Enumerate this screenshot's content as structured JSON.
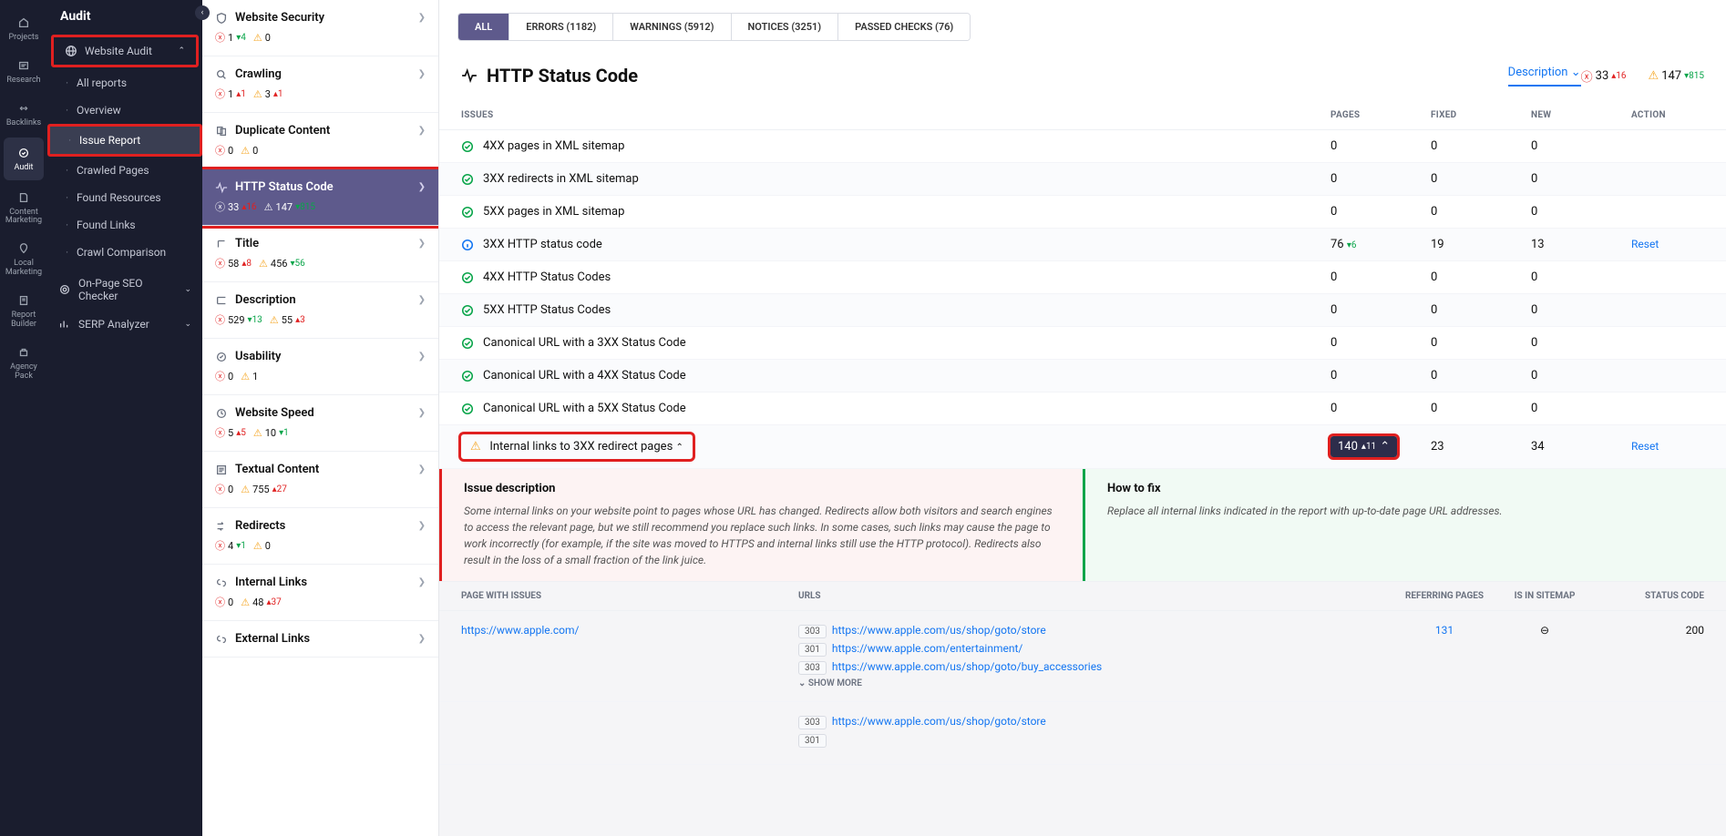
{
  "rail": [
    {
      "label": "Projects",
      "id": "projects"
    },
    {
      "label": "Research",
      "id": "research"
    },
    {
      "label": "Backlinks",
      "id": "backlinks"
    },
    {
      "label": "Audit",
      "id": "audit",
      "active": true
    },
    {
      "label": "Content\nMarketing",
      "id": "content"
    },
    {
      "label": "Local\nMarketing",
      "id": "local"
    },
    {
      "label": "Report\nBuilder",
      "id": "report"
    },
    {
      "label": "Agency\nPack",
      "id": "agency"
    }
  ],
  "sidebar": {
    "title": "Audit",
    "groups": {
      "website_audit": {
        "label": "Website Audit",
        "expanded": true
      },
      "items": [
        {
          "label": "All reports"
        },
        {
          "label": "Overview"
        },
        {
          "label": "Issue Report",
          "active": true
        },
        {
          "label": "Crawled Pages"
        },
        {
          "label": "Found Resources"
        },
        {
          "label": "Found Links"
        },
        {
          "label": "Crawl Comparison"
        }
      ],
      "onpage": {
        "label": "On-Page SEO Checker"
      },
      "serp": {
        "label": "SERP Analyzer"
      }
    }
  },
  "tabs": [
    {
      "label": "ALL",
      "active": true
    },
    {
      "label": "ERRORS (1182)"
    },
    {
      "label": "WARNINGS (5912)"
    },
    {
      "label": "NOTICES (3251)"
    },
    {
      "label": "PASSED CHECKS (76)"
    }
  ],
  "categories": [
    {
      "title": "Website Security",
      "err": "1",
      "err_d": "▾4",
      "warn": "0"
    },
    {
      "title": "Crawling",
      "err": "1",
      "err_d": "▴1",
      "warn": "3",
      "warn_d": "▴1"
    },
    {
      "title": "Duplicate Content",
      "err": "0",
      "warn": "0"
    },
    {
      "title": "HTTP Status Code",
      "active": true,
      "err": "33",
      "err_d": "▴16",
      "warn": "147",
      "warn_d": "▾815"
    },
    {
      "title": "Title",
      "err": "58",
      "err_d": "▴8",
      "warn": "456",
      "warn_d": "▾56"
    },
    {
      "title": "Description",
      "err": "529",
      "err_d": "▾13",
      "warn": "55",
      "warn_d": "▴3"
    },
    {
      "title": "Usability",
      "err": "0",
      "warn": "1"
    },
    {
      "title": "Website Speed",
      "err": "5",
      "err_d": "▴5",
      "warn": "10",
      "warn_d": "▾1"
    },
    {
      "title": "Textual Content",
      "err": "0",
      "warn": "755",
      "warn_d": "▴27"
    },
    {
      "title": "Redirects",
      "err": "4",
      "err_d": "▾1",
      "warn": "0"
    },
    {
      "title": "Internal Links",
      "err": "0",
      "warn": "48",
      "warn_d": "▴37"
    },
    {
      "title": "External Links"
    }
  ],
  "page": {
    "title": "HTTP Status Code",
    "sort_label": "Description",
    "head_err": "33",
    "head_err_d": "▴16",
    "head_warn": "147",
    "head_warn_d": "▾815"
  },
  "columns": {
    "c1": "ISSUES",
    "c2": "PAGES",
    "c3": "FIXED",
    "c4": "NEW",
    "c5": "ACTION"
  },
  "issues": [
    {
      "icon": "ok",
      "label": "4XX pages in XML sitemap",
      "pages": "0",
      "fixed": "0",
      "new": "0"
    },
    {
      "icon": "ok",
      "label": "3XX redirects in XML sitemap",
      "pages": "0",
      "fixed": "0",
      "new": "0"
    },
    {
      "icon": "ok",
      "label": "5XX pages in XML sitemap",
      "pages": "0",
      "fixed": "0",
      "new": "0"
    },
    {
      "icon": "info",
      "label": "3XX HTTP status code",
      "pages": "76",
      "pages_d": "▾6",
      "fixed": "19",
      "new": "13",
      "action": "Reset"
    },
    {
      "icon": "ok",
      "label": "4XX HTTP Status Codes",
      "pages": "0",
      "fixed": "0",
      "new": "0"
    },
    {
      "icon": "ok",
      "label": "5XX HTTP Status Codes",
      "pages": "0",
      "fixed": "0",
      "new": "0"
    },
    {
      "icon": "ok",
      "label": "Canonical URL with a 3XX Status Code",
      "pages": "0",
      "fixed": "0",
      "new": "0"
    },
    {
      "icon": "ok",
      "label": "Canonical URL with a 4XX Status Code",
      "pages": "0",
      "fixed": "0",
      "new": "0"
    },
    {
      "icon": "ok",
      "label": "Canonical URL with a 5XX Status Code",
      "pages": "0",
      "fixed": "0",
      "new": "0"
    },
    {
      "icon": "warn",
      "label": "Internal links to 3XX redirect pages",
      "expanded": true,
      "pages": "140",
      "pages_d": "▴11",
      "fixed": "23",
      "new": "34",
      "action": "Reset",
      "hl": true
    }
  ],
  "guide": {
    "desc_h": "Issue description",
    "desc_t": "Some internal links on your website point to pages whose URL has changed. Redirects allow both visitors and search engines to access the relevant page, but we still recommend you replace such links. In some cases, such links may cause the page to work incorrectly (for example, if the site was moved to HTTPS and internal links still use the HTTP protocol). Redirects also result in the loss of a small fraction of the link juice.",
    "fix_h": "How to fix",
    "fix_t": "Replace all internal links indicated in the report with up-to-date page URL addresses."
  },
  "detail_cols": {
    "c1": "PAGE WITH ISSUES",
    "c2": "URLS",
    "c3": "REFERRING PAGES",
    "c4": "IS IN SITEMAP",
    "c5": "STATUS CODE"
  },
  "detail_rows": [
    {
      "page": "https://www.apple.com/",
      "urls": [
        {
          "code": "303",
          "url": "https://www.apple.com/us/shop/goto/store"
        },
        {
          "code": "301",
          "url": "https://www.apple.com/entertainment/"
        },
        {
          "code": "303",
          "url": "https://www.apple.com/us/shop/goto/buy_accessories"
        }
      ],
      "more": "SHOW MORE",
      "ref": "131",
      "sitemap": "⊖",
      "status": "200"
    },
    {
      "page": "",
      "urls": [
        {
          "code": "303",
          "url": "https://www.apple.com/us/shop/goto/store"
        },
        {
          "code": "301",
          "url": ""
        }
      ]
    }
  ]
}
